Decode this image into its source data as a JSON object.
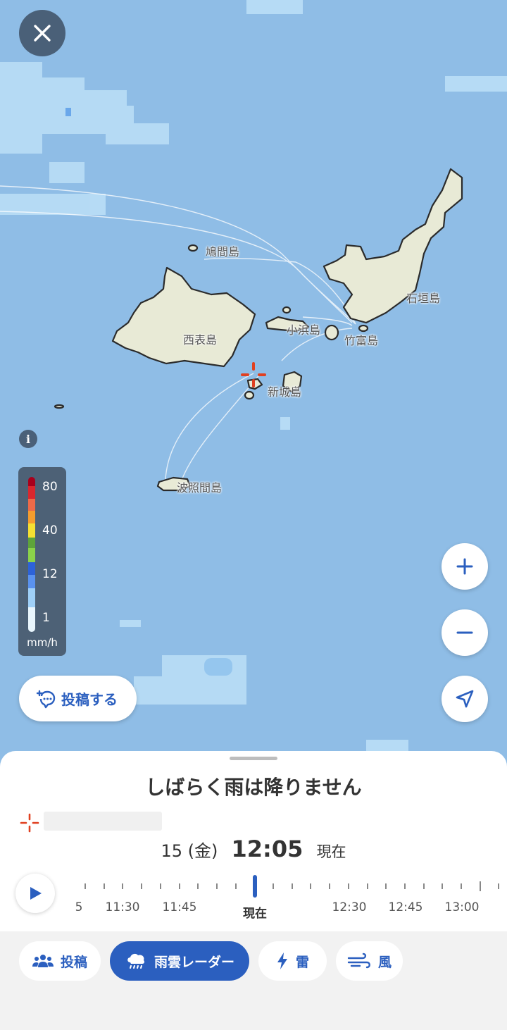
{
  "map": {
    "islands": [
      {
        "id": "hatoma",
        "label": "鳩間島"
      },
      {
        "id": "iriomote",
        "label": "西表島"
      },
      {
        "id": "kohama",
        "label": "小浜島"
      },
      {
        "id": "taketomi",
        "label": "竹富島"
      },
      {
        "id": "ishigaki",
        "label": "石垣島"
      },
      {
        "id": "aragusuku",
        "label": "新城島"
      },
      {
        "id": "hateruma",
        "label": "波照間島"
      }
    ],
    "colors": {
      "sea": "#8fbde6",
      "land": "#e8ead6",
      "rain_light": "#b8dcf5",
      "accent": "#2b5fbf",
      "marker": "#e04020"
    }
  },
  "controls": {
    "close_icon": "close-icon",
    "info_icon_text": "i",
    "zoom_in_icon": "plus-icon",
    "zoom_out_icon": "minus-icon",
    "locate_icon": "navigation-arrow-icon"
  },
  "legend": {
    "values": [
      "80",
      "40",
      "12",
      "1"
    ],
    "unit": "mm/h",
    "colors": [
      "#a8001c",
      "#d9272e",
      "#ee6a48",
      "#f59d2e",
      "#f5e032",
      "#5ea43a",
      "#8bd24a",
      "#2d62d8",
      "#5a92ef",
      "#9fd0f7",
      "#e9f6fd"
    ]
  },
  "post_button": {
    "label": "投稿する"
  },
  "sheet": {
    "status_title": "しばらく雨は降りません",
    "day": "15 (金)",
    "time": "12:05",
    "now": "現在"
  },
  "timeline": {
    "labels": [
      "5",
      "11:30",
      "11:45",
      "現在",
      "12:30",
      "12:45",
      "13:00"
    ]
  },
  "tabs": [
    {
      "label": "投稿",
      "icon": "people-icon"
    },
    {
      "label": "雨雲レーダー",
      "icon": "rain-cloud-icon"
    },
    {
      "label": "雷",
      "icon": "lightning-icon"
    },
    {
      "label": "風",
      "icon": "wind-icon"
    }
  ]
}
